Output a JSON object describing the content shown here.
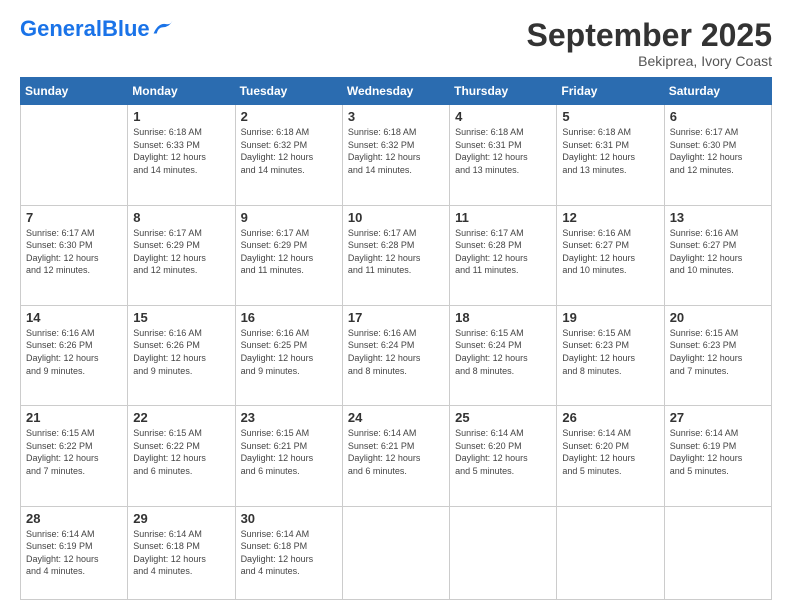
{
  "logo": {
    "part1": "General",
    "part2": "Blue"
  },
  "header": {
    "month": "September 2025",
    "location": "Bekiprea, Ivory Coast"
  },
  "weekdays": [
    "Sunday",
    "Monday",
    "Tuesday",
    "Wednesday",
    "Thursday",
    "Friday",
    "Saturday"
  ],
  "weeks": [
    [
      {
        "day": "",
        "info": ""
      },
      {
        "day": "1",
        "info": "Sunrise: 6:18 AM\nSunset: 6:33 PM\nDaylight: 12 hours\nand 14 minutes."
      },
      {
        "day": "2",
        "info": "Sunrise: 6:18 AM\nSunset: 6:32 PM\nDaylight: 12 hours\nand 14 minutes."
      },
      {
        "day": "3",
        "info": "Sunrise: 6:18 AM\nSunset: 6:32 PM\nDaylight: 12 hours\nand 14 minutes."
      },
      {
        "day": "4",
        "info": "Sunrise: 6:18 AM\nSunset: 6:31 PM\nDaylight: 12 hours\nand 13 minutes."
      },
      {
        "day": "5",
        "info": "Sunrise: 6:18 AM\nSunset: 6:31 PM\nDaylight: 12 hours\nand 13 minutes."
      },
      {
        "day": "6",
        "info": "Sunrise: 6:17 AM\nSunset: 6:30 PM\nDaylight: 12 hours\nand 12 minutes."
      }
    ],
    [
      {
        "day": "7",
        "info": "Sunrise: 6:17 AM\nSunset: 6:30 PM\nDaylight: 12 hours\nand 12 minutes."
      },
      {
        "day": "8",
        "info": "Sunrise: 6:17 AM\nSunset: 6:29 PM\nDaylight: 12 hours\nand 12 minutes."
      },
      {
        "day": "9",
        "info": "Sunrise: 6:17 AM\nSunset: 6:29 PM\nDaylight: 12 hours\nand 11 minutes."
      },
      {
        "day": "10",
        "info": "Sunrise: 6:17 AM\nSunset: 6:28 PM\nDaylight: 12 hours\nand 11 minutes."
      },
      {
        "day": "11",
        "info": "Sunrise: 6:17 AM\nSunset: 6:28 PM\nDaylight: 12 hours\nand 11 minutes."
      },
      {
        "day": "12",
        "info": "Sunrise: 6:16 AM\nSunset: 6:27 PM\nDaylight: 12 hours\nand 10 minutes."
      },
      {
        "day": "13",
        "info": "Sunrise: 6:16 AM\nSunset: 6:27 PM\nDaylight: 12 hours\nand 10 minutes."
      }
    ],
    [
      {
        "day": "14",
        "info": "Sunrise: 6:16 AM\nSunset: 6:26 PM\nDaylight: 12 hours\nand 9 minutes."
      },
      {
        "day": "15",
        "info": "Sunrise: 6:16 AM\nSunset: 6:26 PM\nDaylight: 12 hours\nand 9 minutes."
      },
      {
        "day": "16",
        "info": "Sunrise: 6:16 AM\nSunset: 6:25 PM\nDaylight: 12 hours\nand 9 minutes."
      },
      {
        "day": "17",
        "info": "Sunrise: 6:16 AM\nSunset: 6:24 PM\nDaylight: 12 hours\nand 8 minutes."
      },
      {
        "day": "18",
        "info": "Sunrise: 6:15 AM\nSunset: 6:24 PM\nDaylight: 12 hours\nand 8 minutes."
      },
      {
        "day": "19",
        "info": "Sunrise: 6:15 AM\nSunset: 6:23 PM\nDaylight: 12 hours\nand 8 minutes."
      },
      {
        "day": "20",
        "info": "Sunrise: 6:15 AM\nSunset: 6:23 PM\nDaylight: 12 hours\nand 7 minutes."
      }
    ],
    [
      {
        "day": "21",
        "info": "Sunrise: 6:15 AM\nSunset: 6:22 PM\nDaylight: 12 hours\nand 7 minutes."
      },
      {
        "day": "22",
        "info": "Sunrise: 6:15 AM\nSunset: 6:22 PM\nDaylight: 12 hours\nand 6 minutes."
      },
      {
        "day": "23",
        "info": "Sunrise: 6:15 AM\nSunset: 6:21 PM\nDaylight: 12 hours\nand 6 minutes."
      },
      {
        "day": "24",
        "info": "Sunrise: 6:14 AM\nSunset: 6:21 PM\nDaylight: 12 hours\nand 6 minutes."
      },
      {
        "day": "25",
        "info": "Sunrise: 6:14 AM\nSunset: 6:20 PM\nDaylight: 12 hours\nand 5 minutes."
      },
      {
        "day": "26",
        "info": "Sunrise: 6:14 AM\nSunset: 6:20 PM\nDaylight: 12 hours\nand 5 minutes."
      },
      {
        "day": "27",
        "info": "Sunrise: 6:14 AM\nSunset: 6:19 PM\nDaylight: 12 hours\nand 5 minutes."
      }
    ],
    [
      {
        "day": "28",
        "info": "Sunrise: 6:14 AM\nSunset: 6:19 PM\nDaylight: 12 hours\nand 4 minutes."
      },
      {
        "day": "29",
        "info": "Sunrise: 6:14 AM\nSunset: 6:18 PM\nDaylight: 12 hours\nand 4 minutes."
      },
      {
        "day": "30",
        "info": "Sunrise: 6:14 AM\nSunset: 6:18 PM\nDaylight: 12 hours\nand 4 minutes."
      },
      {
        "day": "",
        "info": ""
      },
      {
        "day": "",
        "info": ""
      },
      {
        "day": "",
        "info": ""
      },
      {
        "day": "",
        "info": ""
      }
    ]
  ]
}
